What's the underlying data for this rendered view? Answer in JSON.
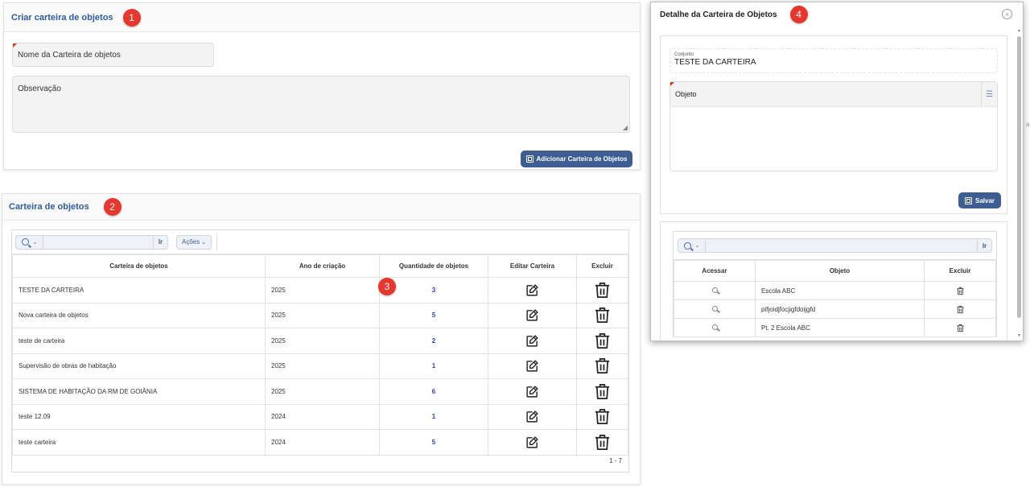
{
  "create_panel": {
    "title": "Criar carteira de objetos",
    "badge": "1",
    "name_placeholder": "Nome da Carteira de objetos",
    "obs_placeholder": "Observação",
    "add_button": "Adicionar Carteira de Objetos"
  },
  "list_panel": {
    "title": "Carteira de objetos",
    "badge": "2",
    "search": {
      "go_label": "Ir",
      "actions_label": "Ações"
    },
    "columns": [
      "Carteira de objetos",
      "Ano de criação",
      "Quantidade de objetos",
      "Editar Carteira",
      "Excluir"
    ],
    "rows": [
      {
        "name": "TESTE DA CARTEIRA",
        "year": "2025",
        "qty": "3"
      },
      {
        "name": "Nova carteira de objetos",
        "year": "2025",
        "qty": "5"
      },
      {
        "name": "teste de carteira",
        "year": "2025",
        "qty": "2"
      },
      {
        "name": "Supervisão de obras de habitação",
        "year": "2025",
        "qty": "1"
      },
      {
        "name": "SISTEMA DE HABITAÇÃO DA RM DE GOIÂNIA",
        "year": "2025",
        "qty": "6"
      },
      {
        "name": "teste 12.09",
        "year": "2024",
        "qty": "1"
      },
      {
        "name": "teste carteira",
        "year": "2024",
        "qty": "5"
      }
    ],
    "qty_badge": "3",
    "pagination": "1 - 7"
  },
  "modal": {
    "title": "Detalhe da Carteira de Objetos",
    "badge": "4",
    "conjunto_label": "Conjunto",
    "conjunto_value": "TESTE DA CARTEIRA",
    "objeto_label": "Objeto",
    "save_button": "Salvar",
    "search_go": "Ir",
    "columns": [
      "Acessar",
      "Objeto",
      "Excluir"
    ],
    "rows": [
      {
        "objeto": "Escola ABC"
      },
      {
        "objeto": "pifjoidjfocjigfdoijgfd"
      },
      {
        "objeto": "Pt. 2 Escola ABC"
      }
    ]
  },
  "colors": {
    "accent": "#3e5e93",
    "title": "#2e5b9a",
    "badge": "#e5372e",
    "qty_link": "#2a3ec4"
  }
}
